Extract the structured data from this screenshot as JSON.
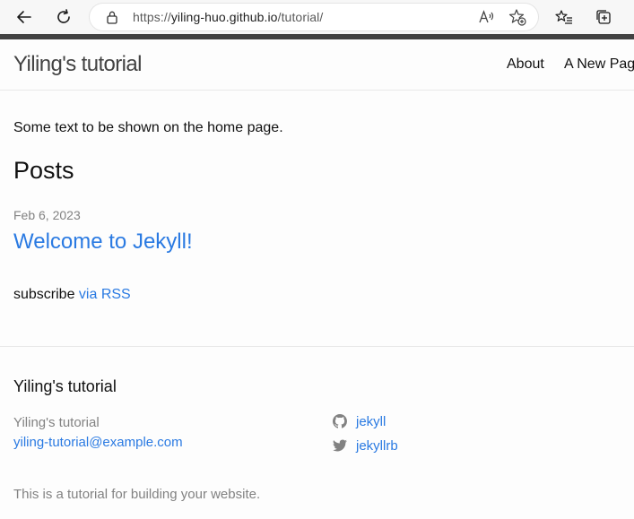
{
  "browser": {
    "url_prefix": "https://",
    "url_domain": "yiling-huo.github.io",
    "url_path": "/tutorial/",
    "icons": [
      "back-arrow-icon",
      "refresh-icon",
      "lock-icon",
      "read-aloud-icon",
      "add-favorite-icon",
      "favorites-icon",
      "collections-icon"
    ]
  },
  "header": {
    "site_title": "Yiling's tutorial",
    "nav": [
      "About",
      "A New Pag"
    ]
  },
  "main": {
    "intro": "Some text to be shown on the home page.",
    "posts_heading": "Posts",
    "posts": [
      {
        "date": "Feb 6, 2023",
        "title": "Welcome to Jekyll!"
      }
    ],
    "subscribe_prefix": "subscribe ",
    "subscribe_link": "via RSS"
  },
  "footer": {
    "heading": "Yiling's tutorial",
    "name": "Yiling's tutorial",
    "email": "yiling-tutorial@example.com",
    "social": [
      {
        "icon": "github-icon",
        "label": "jekyll"
      },
      {
        "icon": "twitter-icon",
        "label": "jekyllrb"
      }
    ],
    "description": "This is a tutorial for building your website."
  },
  "colors": {
    "link": "#2a7ae2",
    "text": "#111111",
    "muted": "#828282",
    "top_strip": "#424242"
  }
}
